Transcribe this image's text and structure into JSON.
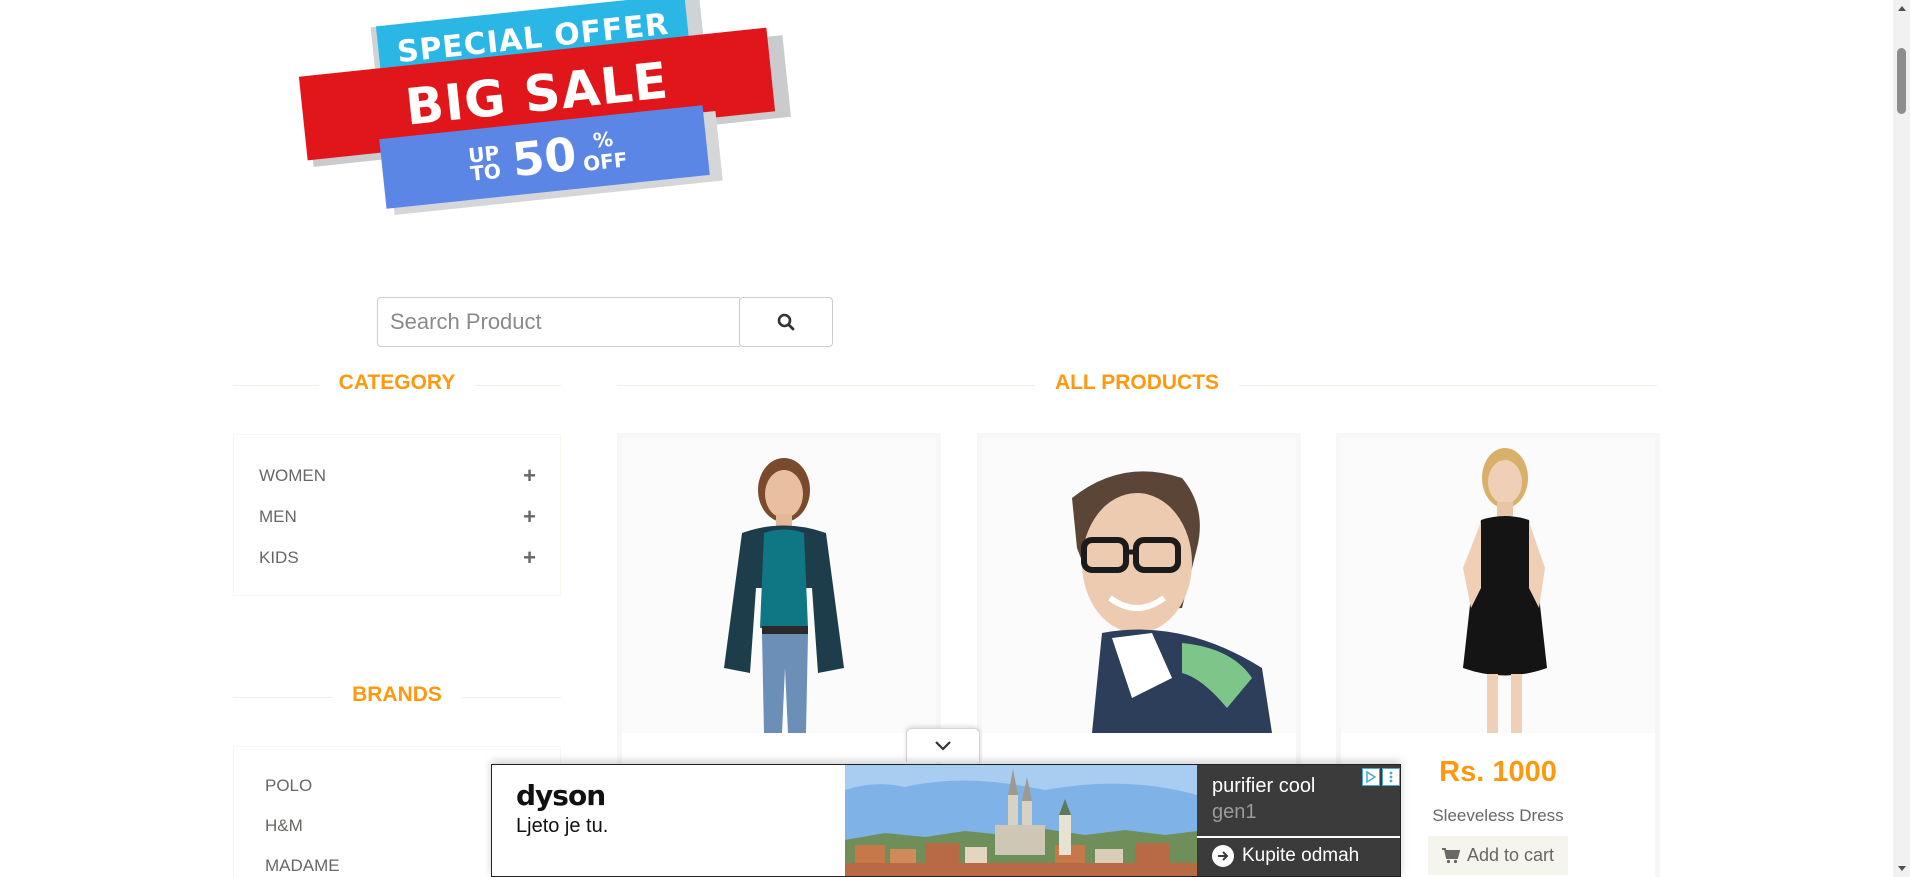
{
  "banner": {
    "line1": "SPECIAL OFFER",
    "line2": "BIG SALE",
    "upto": "UP TO",
    "percent": "50",
    "pct_sign": "%",
    "off": "OFF"
  },
  "search": {
    "placeholder": "Search Product",
    "icon": "search-icon"
  },
  "category": {
    "title": "CATEGORY",
    "items": [
      {
        "label": "WOMEN",
        "icon": "plus-icon"
      },
      {
        "label": "MEN",
        "icon": "plus-icon"
      },
      {
        "label": "KIDS",
        "icon": "plus-icon"
      }
    ]
  },
  "brands": {
    "title": "BRANDS",
    "items": [
      "POLO",
      "H&M",
      "MADAME"
    ]
  },
  "products": {
    "title": "ALL PRODUCTS",
    "cart_label": "Add to cart",
    "items": [
      {
        "image": "woman-casual-photo"
      },
      {
        "image": "man-glasses-photo"
      },
      {
        "image": "woman-black-dress-photo",
        "price": "Rs. 1000",
        "name": "Sleeveless Dress"
      }
    ]
  },
  "ad": {
    "brand": "dyson",
    "slogan": "Ljeto je tu.",
    "product_line1": "purifier cool",
    "product_line2": "gen1",
    "cta": "Kupite odmah"
  },
  "colors": {
    "accent": "#fe980f",
    "text": "#696763"
  }
}
